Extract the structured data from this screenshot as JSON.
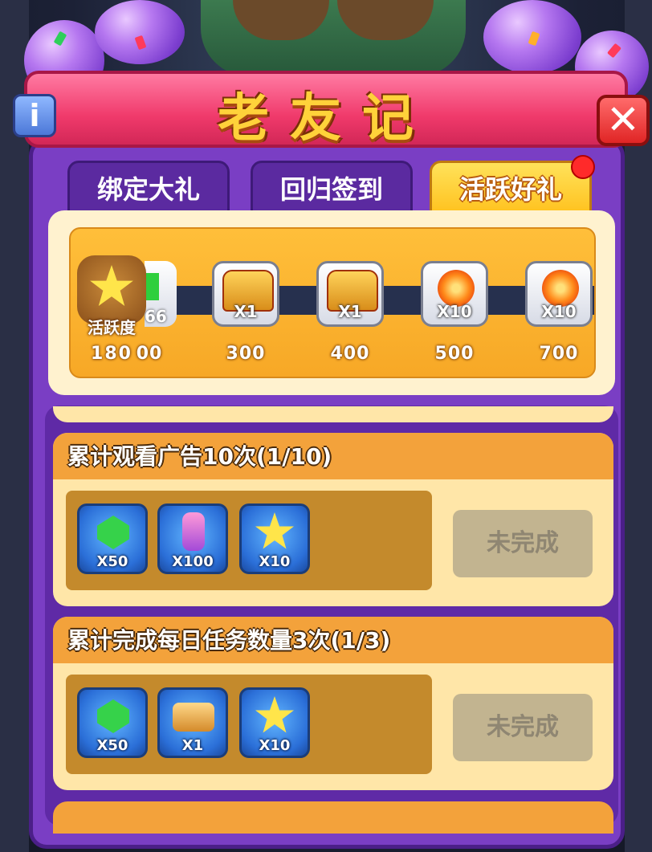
{
  "banner": {
    "title": "老友记"
  },
  "tabs": [
    {
      "label": "绑定大礼",
      "active": false
    },
    {
      "label": "回归签到",
      "active": false
    },
    {
      "label": "活跃好礼",
      "active": true
    }
  ],
  "activity": {
    "label": "活跃度",
    "value": "180",
    "milestones": [
      {
        "qty": "66",
        "threshold": "00",
        "icon": "green-gem-icon"
      },
      {
        "qty": "X1",
        "threshold": "300",
        "icon": "purple-chest-icon"
      },
      {
        "qty": "X1",
        "threshold": "400",
        "icon": "blue-chest-icon"
      },
      {
        "qty": "X10",
        "threshold": "500",
        "icon": "fire-orb-icon"
      },
      {
        "qty": "X10",
        "threshold": "700",
        "icon": "fire-orb-icon"
      }
    ]
  },
  "tasks": [
    {
      "title": "累计观看广告10次(1/10)",
      "status": "未完成",
      "rewards": [
        {
          "qty": "X50",
          "icon": "green-gem-icon"
        },
        {
          "qty": "X100",
          "icon": "potion-icon"
        },
        {
          "qty": "X10",
          "icon": "star-icon"
        }
      ]
    },
    {
      "title": "累计完成每日任务数量3次(1/3)",
      "status": "未完成",
      "rewards": [
        {
          "qty": "X50",
          "icon": "green-gem-icon"
        },
        {
          "qty": "X1",
          "icon": "ticket-icon"
        },
        {
          "qty": "X10",
          "icon": "star-icon"
        }
      ]
    },
    {
      "title": "",
      "status": "",
      "rewards": []
    }
  ],
  "colors": {
    "panel": "#7a3ec4",
    "banner": "#f03a6b",
    "tab_active": "#ffc21f",
    "task_header": "#f3a23b",
    "status_disabled": "#c2b490"
  }
}
